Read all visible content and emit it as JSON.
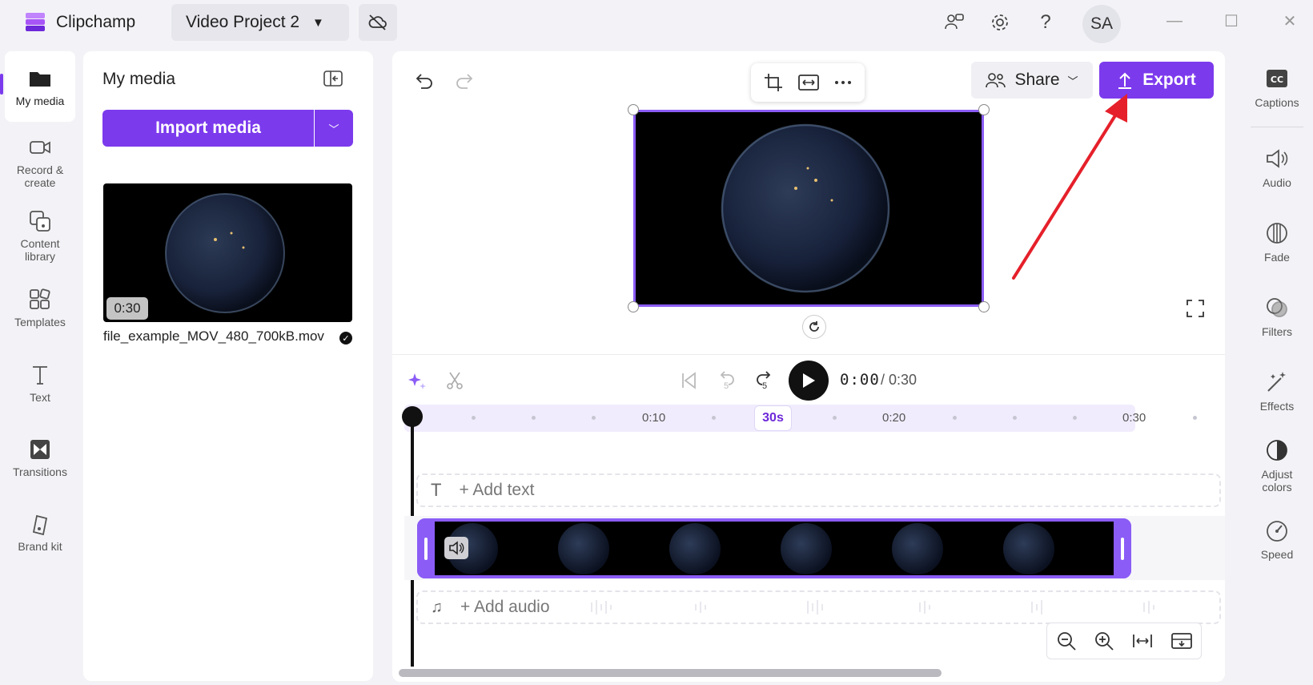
{
  "app": {
    "name": "Clipchamp",
    "project_name": "Video Project 2",
    "avatar_initials": "SA"
  },
  "left_nav": [
    {
      "label": "My media"
    },
    {
      "label": "Record &\ncreate"
    },
    {
      "label": "Content\nlibrary"
    },
    {
      "label": "Templates"
    },
    {
      "label": "Text"
    },
    {
      "label": "Transitions"
    },
    {
      "label": "Brand kit"
    }
  ],
  "media_panel": {
    "title": "My media",
    "import_label": "Import media",
    "item": {
      "filename": "file_example_MOV_480_700kB.mov",
      "duration": "0:30"
    }
  },
  "editor": {
    "share_label": "Share",
    "export_label": "Export"
  },
  "playback": {
    "current_time": "0:00",
    "total_time": "/ 0:30",
    "skip_back_seconds": "5",
    "skip_forward_seconds": "5"
  },
  "timeline": {
    "ticks": [
      "0:10",
      "0:20",
      "0:30"
    ],
    "zoom_chip": "30s",
    "add_text": "+ Add text",
    "add_audio": "+ Add audio"
  },
  "right_panel": [
    {
      "label": "Captions"
    },
    {
      "label": "Audio"
    },
    {
      "label": "Fade"
    },
    {
      "label": "Filters"
    },
    {
      "label": "Effects"
    },
    {
      "label": "Adjust\ncolors"
    },
    {
      "label": "Speed"
    }
  ],
  "colors": {
    "accent": "#7c3aed",
    "clip_border": "#8b5cf6",
    "annotation_arrow": "#e5202a"
  }
}
